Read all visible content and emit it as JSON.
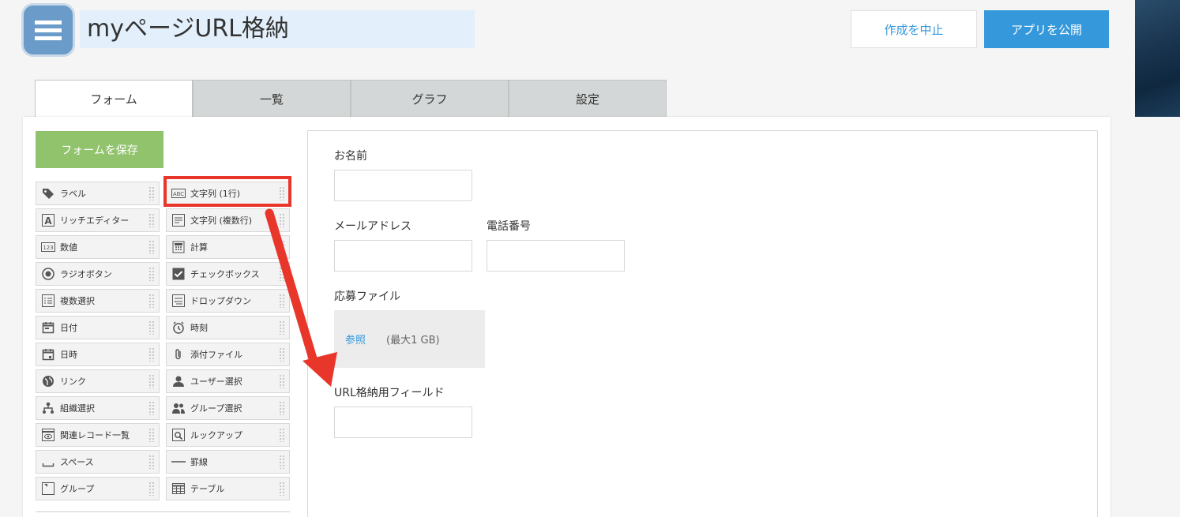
{
  "header": {
    "app_name": "myページURL格納",
    "cancel_label": "作成を中止",
    "publish_label": "アプリを公開"
  },
  "tabs": [
    {
      "label": "フォーム"
    },
    {
      "label": "一覧"
    },
    {
      "label": "グラフ"
    },
    {
      "label": "設定"
    }
  ],
  "save_form_label": "フォームを保存",
  "palette": [
    {
      "label": "ラベル",
      "icon": "tag-icon"
    },
    {
      "label": "文字列 (1行)",
      "icon": "abc-icon"
    },
    {
      "label": "リッチエディター",
      "icon": "rich-editor-icon"
    },
    {
      "label": "文字列 (複数行)",
      "icon": "multiline-icon"
    },
    {
      "label": "数値",
      "icon": "number-icon"
    },
    {
      "label": "計算",
      "icon": "calculator-icon"
    },
    {
      "label": "ラジオボタン",
      "icon": "radio-icon"
    },
    {
      "label": "チェックボックス",
      "icon": "checkbox-icon"
    },
    {
      "label": "複数選択",
      "icon": "multi-select-icon"
    },
    {
      "label": "ドロップダウン",
      "icon": "dropdown-icon"
    },
    {
      "label": "日付",
      "icon": "calendar-icon"
    },
    {
      "label": "時刻",
      "icon": "clock-icon"
    },
    {
      "label": "日時",
      "icon": "datetime-icon"
    },
    {
      "label": "添付ファイル",
      "icon": "paperclip-icon"
    },
    {
      "label": "リンク",
      "icon": "globe-icon"
    },
    {
      "label": "ユーザー選択",
      "icon": "user-icon"
    },
    {
      "label": "組織選択",
      "icon": "org-icon"
    },
    {
      "label": "グループ選択",
      "icon": "group-icon"
    },
    {
      "label": "関連レコード一覧",
      "icon": "related-records-icon"
    },
    {
      "label": "ルックアップ",
      "icon": "lookup-icon"
    },
    {
      "label": "スペース",
      "icon": "space-icon"
    },
    {
      "label": "罫線",
      "icon": "line-icon"
    },
    {
      "label": "グループ",
      "icon": "group-field-icon"
    },
    {
      "label": "テーブル",
      "icon": "table-icon"
    }
  ],
  "form": {
    "name_label": "お名前",
    "email_label": "メールアドレス",
    "phone_label": "電話番号",
    "file_label": "応募ファイル",
    "file_browse": "参照",
    "file_limit": "(最大1 GB)",
    "url_label": "URL格納用フィールド"
  },
  "colors": {
    "accent_blue": "#3498db",
    "save_green": "#91c36c",
    "highlight_red": "#e8362b"
  }
}
